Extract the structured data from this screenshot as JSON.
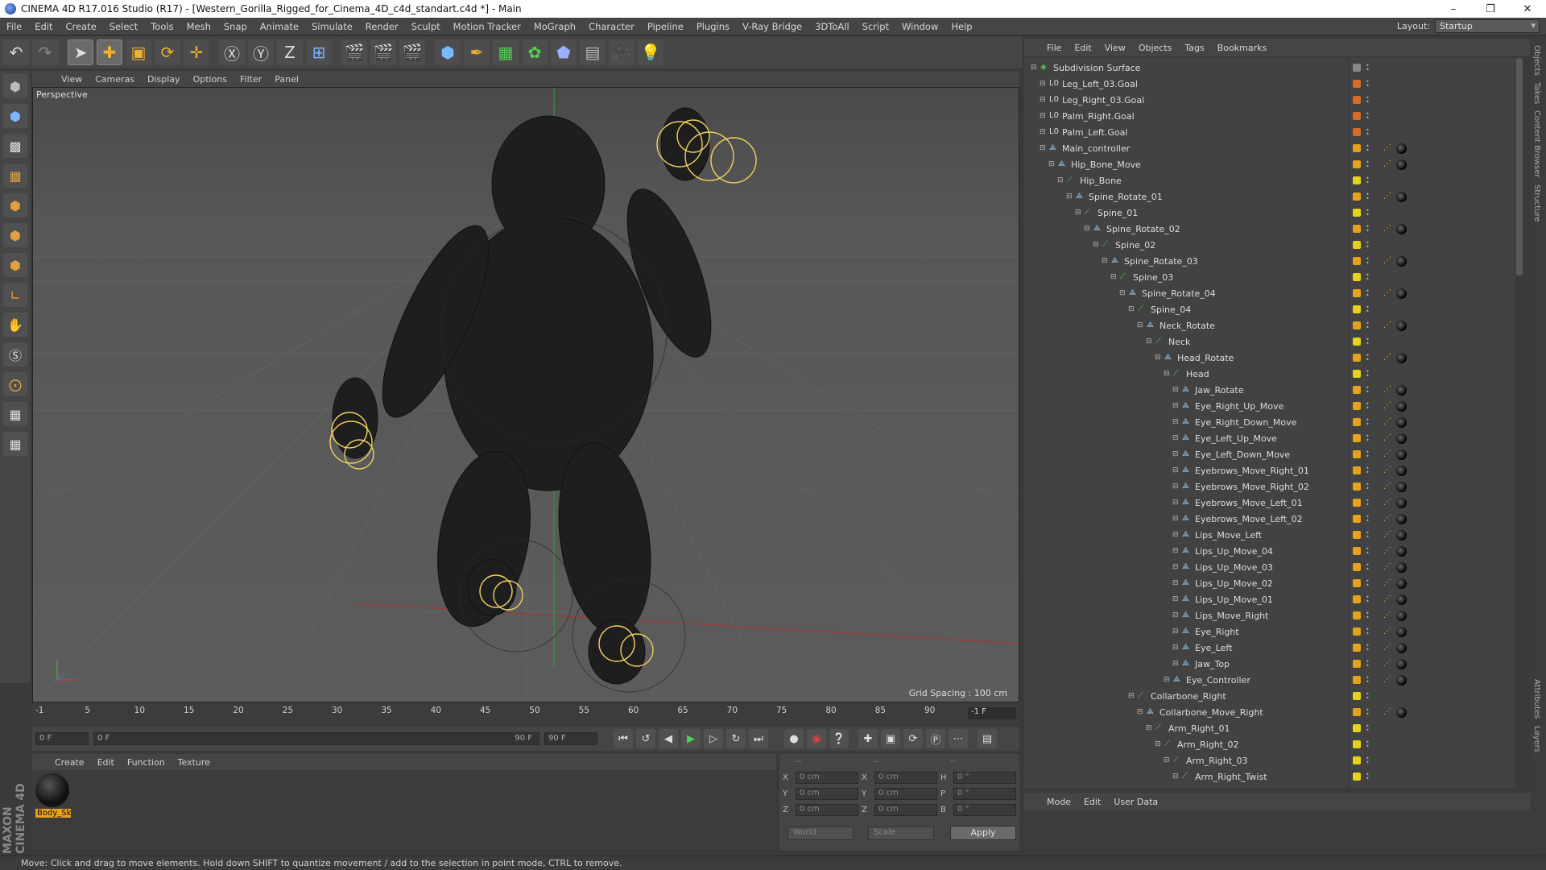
{
  "window": {
    "title": "CINEMA 4D R17.016 Studio (R17) - [Western_Gorilla_Rigged_for_Cinema_4D_c4d_standart.c4d *] - Main"
  },
  "menubar": [
    "File",
    "Edit",
    "Create",
    "Select",
    "Tools",
    "Mesh",
    "Snap",
    "Animate",
    "Simulate",
    "Render",
    "Sculpt",
    "Motion Tracker",
    "MoGraph",
    "Character",
    "Pipeline",
    "Plugins",
    "V-Ray Bridge",
    "3DToAll",
    "Script",
    "Window",
    "Help"
  ],
  "layout": {
    "label": "Layout:",
    "value": "Startup"
  },
  "viewport": {
    "menu": [
      "View",
      "Cameras",
      "Display",
      "Options",
      "Filter",
      "Panel"
    ],
    "camera": "Perspective",
    "grid_spacing": "Grid Spacing : 100 cm"
  },
  "timeline": {
    "ticks": [
      "-1",
      "5",
      "10",
      "15",
      "20",
      "25",
      "30",
      "35",
      "40",
      "45",
      "50",
      "55",
      "60",
      "65",
      "70",
      "75",
      "80",
      "85",
      "90"
    ],
    "current": "-1 F",
    "start": "0 F",
    "range_start": "0 F",
    "range_end": "90 F",
    "end": "90 F"
  },
  "material_manager": {
    "menu": [
      "Create",
      "Edit",
      "Function",
      "Texture"
    ],
    "materials": [
      {
        "name": "Body_Sk"
      }
    ]
  },
  "coordinates": {
    "headers": [
      "--",
      "--",
      "--"
    ],
    "rows": [
      {
        "a": "X",
        "av": "0 cm",
        "b": "X",
        "bv": "0 cm",
        "c": "H",
        "cv": "0 °"
      },
      {
        "a": "Y",
        "av": "0 cm",
        "b": "Y",
        "bv": "0 cm",
        "c": "P",
        "cv": "0 °"
      },
      {
        "a": "Z",
        "av": "0 cm",
        "b": "Z",
        "bv": "0 cm",
        "c": "B",
        "cv": "0 °"
      }
    ],
    "space": "World",
    "mode": "Scale",
    "apply": "Apply"
  },
  "status": "Move: Click and drag to move elements. Hold down SHIFT to quantize movement / add to the selection in point mode, CTRL to remove.",
  "object_manager": {
    "menu": [
      "File",
      "Edit",
      "View",
      "Objects",
      "Tags",
      "Bookmarks"
    ],
    "objects": [
      {
        "name": "Subdivision Surface",
        "depth": 0,
        "icon": "subdiv-icon",
        "color": "#888888"
      },
      {
        "name": "Leg_Left_03.Goal",
        "depth": 1,
        "icon": "null-icon",
        "color": "#d86a2a"
      },
      {
        "name": "Leg_Right_03.Goal",
        "depth": 1,
        "icon": "null-icon",
        "color": "#d86a2a"
      },
      {
        "name": "Palm_Right.Goal",
        "depth": 1,
        "icon": "null-icon",
        "color": "#d86a2a"
      },
      {
        "name": "Palm_Left.Goal",
        "depth": 1,
        "icon": "null-icon",
        "color": "#d86a2a"
      },
      {
        "name": "Main_controller",
        "depth": 1,
        "icon": "joint-icon",
        "color": "#e6a21a"
      },
      {
        "name": "Hip_Bone_Move",
        "depth": 2,
        "icon": "joint-icon",
        "color": "#e6a21a"
      },
      {
        "name": "Hip_Bone",
        "depth": 3,
        "icon": "bone-icon",
        "color": "#e6d21a"
      },
      {
        "name": "Spine_Rotate_01",
        "depth": 4,
        "icon": "joint-icon",
        "color": "#e6a21a"
      },
      {
        "name": "Spine_01",
        "depth": 5,
        "icon": "bone-icon",
        "color": "#e6d21a"
      },
      {
        "name": "Spine_Rotate_02",
        "depth": 6,
        "icon": "joint-icon",
        "color": "#e6a21a"
      },
      {
        "name": "Spine_02",
        "depth": 7,
        "icon": "bone-icon",
        "color": "#e6d21a"
      },
      {
        "name": "Spine_Rotate_03",
        "depth": 8,
        "icon": "joint-icon",
        "color": "#e6a21a"
      },
      {
        "name": "Spine_03",
        "depth": 9,
        "icon": "bone-icon",
        "color": "#e6d21a"
      },
      {
        "name": "Spine_Rotate_04",
        "depth": 10,
        "icon": "joint-icon",
        "color": "#e6a21a"
      },
      {
        "name": "Spine_04",
        "depth": 11,
        "icon": "bone-icon",
        "color": "#e6d21a"
      },
      {
        "name": "Neck_Rotate",
        "depth": 12,
        "icon": "joint-icon",
        "color": "#e6a21a"
      },
      {
        "name": "Neck",
        "depth": 13,
        "icon": "bone-icon",
        "color": "#e6d21a"
      },
      {
        "name": "Head_Rotate",
        "depth": 14,
        "icon": "joint-icon",
        "color": "#e6a21a"
      },
      {
        "name": "Head",
        "depth": 15,
        "icon": "bone-icon",
        "color": "#e6d21a"
      },
      {
        "name": "Jaw_Rotate",
        "depth": 16,
        "icon": "joint-icon",
        "color": "#e6a21a"
      },
      {
        "name": "Eye_Right_Up_Move",
        "depth": 16,
        "icon": "joint-icon",
        "color": "#e6a21a"
      },
      {
        "name": "Eye_Right_Down_Move",
        "depth": 16,
        "icon": "joint-icon",
        "color": "#e6a21a"
      },
      {
        "name": "Eye_Left_Up_Move",
        "depth": 16,
        "icon": "joint-icon",
        "color": "#e6a21a"
      },
      {
        "name": "Eye_Left_Down_Move",
        "depth": 16,
        "icon": "joint-icon",
        "color": "#e6a21a"
      },
      {
        "name": "Eyebrows_Move_Right_01",
        "depth": 16,
        "icon": "joint-icon",
        "color": "#e6a21a"
      },
      {
        "name": "Eyebrows_Move_Right_02",
        "depth": 16,
        "icon": "joint-icon",
        "color": "#e6a21a"
      },
      {
        "name": "Eyebrows_Move_Left_01",
        "depth": 16,
        "icon": "joint-icon",
        "color": "#e6a21a"
      },
      {
        "name": "Eyebrows_Move_Left_02",
        "depth": 16,
        "icon": "joint-icon",
        "color": "#e6a21a"
      },
      {
        "name": "Lips_Move_Left",
        "depth": 16,
        "icon": "joint-icon",
        "color": "#e6a21a"
      },
      {
        "name": "Lips_Up_Move_04",
        "depth": 16,
        "icon": "joint-icon",
        "color": "#e6a21a"
      },
      {
        "name": "Lips_Up_Move_03",
        "depth": 16,
        "icon": "joint-icon",
        "color": "#e6a21a"
      },
      {
        "name": "Lips_Up_Move_02",
        "depth": 16,
        "icon": "joint-icon",
        "color": "#e6a21a"
      },
      {
        "name": "Lips_Up_Move_01",
        "depth": 16,
        "icon": "joint-icon",
        "color": "#e6a21a"
      },
      {
        "name": "Lips_Move_Right",
        "depth": 16,
        "icon": "joint-icon",
        "color": "#e6a21a"
      },
      {
        "name": "Eye_Right",
        "depth": 16,
        "icon": "joint-icon",
        "color": "#e6a21a"
      },
      {
        "name": "Eye_Left",
        "depth": 16,
        "icon": "joint-icon",
        "color": "#e6a21a"
      },
      {
        "name": "Jaw_Top",
        "depth": 16,
        "icon": "joint-icon",
        "color": "#e6a21a"
      },
      {
        "name": "Eye_Controller",
        "depth": 15,
        "icon": "joint-icon",
        "color": "#e6a21a"
      },
      {
        "name": "Collarbone_Right",
        "depth": 11,
        "icon": "bone-icon",
        "color": "#e6d21a"
      },
      {
        "name": "Collarbone_Move_Right",
        "depth": 12,
        "icon": "joint-icon",
        "color": "#e6a21a"
      },
      {
        "name": "Arm_Right_01",
        "depth": 13,
        "icon": "bone-icon",
        "color": "#e6d21a"
      },
      {
        "name": "Arm_Right_02",
        "depth": 14,
        "icon": "bone-icon",
        "color": "#e6d21a"
      },
      {
        "name": "Arm_Right_03",
        "depth": 15,
        "icon": "bone-icon",
        "color": "#e6d21a"
      },
      {
        "name": "Arm_Right_Twist",
        "depth": 16,
        "icon": "bone-icon",
        "color": "#e6d21a"
      }
    ]
  },
  "attributes": {
    "menu": [
      "Mode",
      "Edit",
      "User Data"
    ]
  },
  "side_tabs": [
    "Objects",
    "Takes",
    "Content Browser",
    "Structure"
  ],
  "side_tabs_bottom": [
    "Attributes",
    "Layers"
  ]
}
